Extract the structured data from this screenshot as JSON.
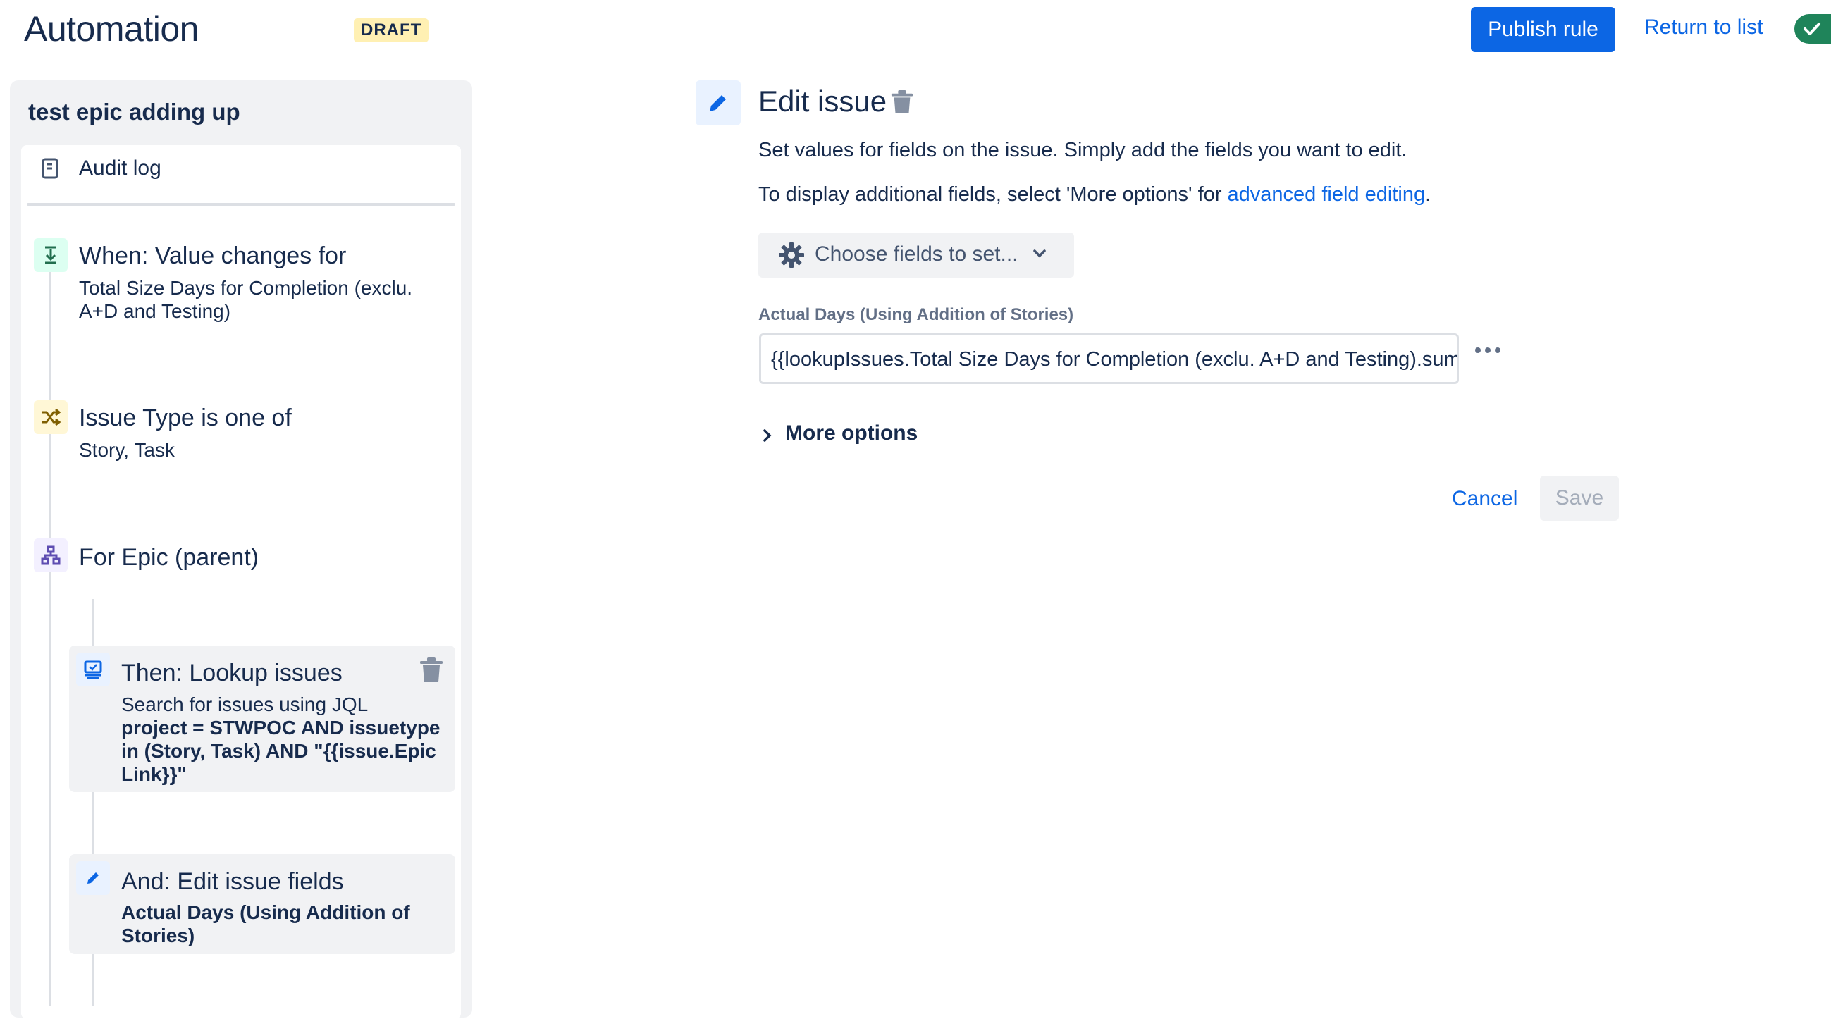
{
  "header": {
    "title": "Automation",
    "status_badge": "DRAFT",
    "publish_label": "Publish rule",
    "return_label": "Return to list"
  },
  "rule": {
    "name": "test epic adding up",
    "audit_log_label": "Audit log",
    "components": [
      {
        "title": "When: Value changes for",
        "subtitle": "Total Size Days for Completion (exclu. A+D and Testing)",
        "icon": "download-arrow-icon"
      },
      {
        "title": "Issue Type is one of",
        "subtitle": "Story, Task",
        "icon": "shuffle-icon"
      },
      {
        "title": "For Epic (parent)",
        "icon": "hierarchy-icon"
      },
      {
        "title": "Then: Lookup issues",
        "subtitle": "Search for issues using JQL",
        "detail": "project = STWPOC AND issuetype in (Story, Task) AND \"{{issue.Epic Link}}\"",
        "icon": "lookup-issues-icon"
      },
      {
        "title": "And: Edit issue fields",
        "detail": "Actual Days (Using Addition of Stories)",
        "icon": "pencil-icon"
      }
    ]
  },
  "editor": {
    "title": "Edit issue",
    "desc1": "Set values for fields on the issue. Simply add the fields you want to edit.",
    "desc2_prefix": "To display additional fields, select 'More options' for ",
    "desc2_link": "advanced field editing",
    "desc2_suffix": ".",
    "choose_fields_label": "Choose fields to set...",
    "field_label": "Actual Days (Using Addition of Stories)",
    "field_value": "{{lookupIssues.Total Size Days for Completion (exclu. A+D and Testing).sum",
    "more_options_label": "More options",
    "cancel_label": "Cancel",
    "save_label": "Save"
  },
  "colors": {
    "primary": "#0c66e4",
    "enabled_toggle": "#1f845a",
    "badge_bg": "#fff0b3",
    "trigger_icon_bg": "#dcfff1",
    "condition_icon_bg": "#fff7d6",
    "branch_icon_bg": "#f3f0ff",
    "action_icon_bg": "#e9f2ff"
  }
}
